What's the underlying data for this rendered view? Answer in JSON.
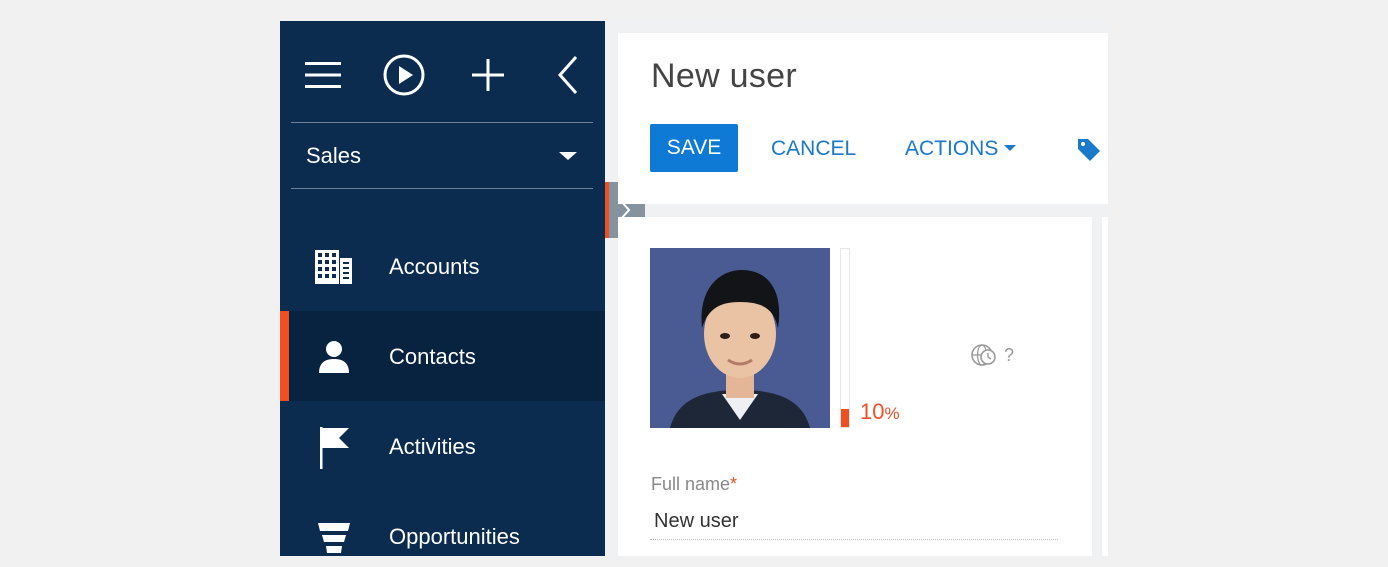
{
  "sidebar": {
    "workspace": {
      "label": "Sales"
    },
    "items": [
      {
        "label": "Accounts",
        "icon": "building-icon"
      },
      {
        "label": "Contacts",
        "icon": "person-icon",
        "active": true
      },
      {
        "label": "Activities",
        "icon": "flag-icon"
      },
      {
        "label": "Opportunities",
        "icon": "funnel-icon"
      }
    ]
  },
  "header": {
    "title": "New user",
    "save_label": "SAVE",
    "cancel_label": "CANCEL",
    "actions_label": "ACTIONS"
  },
  "profile": {
    "completeness_value": 10,
    "completeness_label": "10",
    "completeness_unit": "%",
    "timezone_label": "?"
  },
  "form": {
    "full_name": {
      "label": "Full name",
      "required_mark": "*",
      "value": "New user"
    }
  },
  "colors": {
    "sidebar_bg": "#0b2c4f",
    "accent": "#f04f22",
    "primary": "#0e7ad6"
  }
}
